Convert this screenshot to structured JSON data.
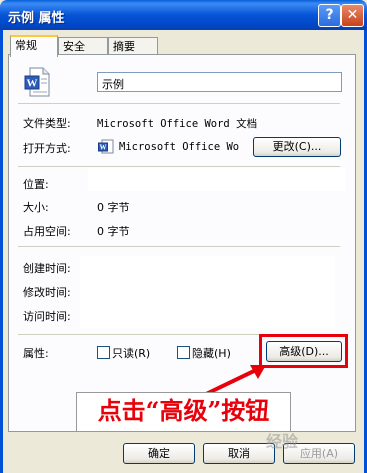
{
  "window": {
    "title": "示例 属性",
    "help_label": "?",
    "close_label": "✕"
  },
  "tabs": [
    {
      "label": "常规"
    },
    {
      "label": "安全"
    },
    {
      "label": "摘要"
    }
  ],
  "general": {
    "name_value": "示例",
    "file_type_label": "文件类型:",
    "file_type_value": "Microsoft Office Word 文档",
    "opens_with_label": "打开方式:",
    "opens_with_value": "Microsoft Office Wo",
    "change_button": "更改(C)...",
    "location_label": "位置:",
    "size_label": "大小:",
    "size_value": "0 字节",
    "size_on_disk_label": "占用空间:",
    "size_on_disk_value": "0 字节",
    "created_label": "创建时间:",
    "modified_label": "修改时间:",
    "accessed_label": "访问时间:",
    "attributes_label": "属性:",
    "readonly_label": "只读(R)",
    "hidden_label": "隐藏(H)",
    "advanced_button": "高级(D)...",
    "readonly_checked": false,
    "hidden_checked": false
  },
  "annotation": {
    "text": "点击“高级”按钮",
    "color": "#E8000B"
  },
  "footer": {
    "ok_button": "确定",
    "cancel_button": "取消",
    "apply_button": "应用(A)"
  },
  "watermark": {
    "text": "经验"
  },
  "icons": {
    "file_icon": "word-document-icon",
    "app_icon": "word-app-icon"
  }
}
